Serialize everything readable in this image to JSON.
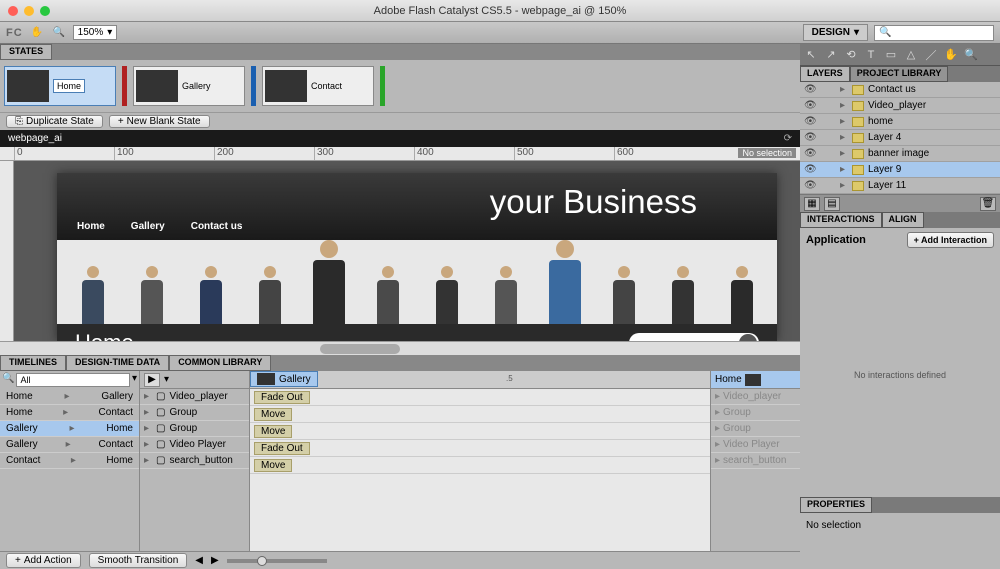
{
  "titlebar": {
    "text": "Adobe Flash Catalyst CS5.5 - webpage_ai @ 150%"
  },
  "toolbar": {
    "fc": "FC",
    "zoom": "150%",
    "design": "DESIGN"
  },
  "states": {
    "tab": "STATES",
    "items": [
      {
        "label": "Home",
        "active": true,
        "barColor": "#b02020"
      },
      {
        "label": "Gallery",
        "active": false,
        "barColor": "#1a5fb0"
      },
      {
        "label": "Contact",
        "active": false,
        "barColor": "#2aa52a"
      }
    ],
    "dup": "Duplicate State",
    "newblank": "New Blank State"
  },
  "canvas": {
    "doc": "webpage_ai",
    "nosel": "No selection",
    "hero_title": "your Business",
    "nav": [
      "Home",
      "Gallery",
      "Contact us"
    ],
    "page_heading": "Home"
  },
  "layers": {
    "tab1": "LAYERS",
    "tab2": "PROJECT LIBRARY",
    "items": [
      "Contact us",
      "Video_player",
      "home",
      "Layer 4",
      "banner image",
      "Layer 9",
      "Layer 11"
    ],
    "selected": 5
  },
  "interactions": {
    "tab1": "INTERACTIONS",
    "tab2": "ALIGN",
    "heading": "Application",
    "add": "+  Add Interaction",
    "empty": "No interactions defined"
  },
  "properties": {
    "tab": "PROPERTIES",
    "text": "No selection"
  },
  "timelines": {
    "tab1": "TIMELINES",
    "tab2": "DESIGN-TIME DATA",
    "tab3": "COMMON LIBRARY",
    "search": "All",
    "transitions": [
      {
        "from": "Home",
        "to": "Gallery"
      },
      {
        "from": "Home",
        "to": "Contact"
      },
      {
        "from": "Gallery",
        "to": "Home"
      },
      {
        "from": "Gallery",
        "to": "Contact"
      },
      {
        "from": "Contact",
        "to": "Home"
      }
    ],
    "sel_trans": 2,
    "mid_items": [
      "Video_player",
      "Group",
      "Group",
      "Video Player",
      "search_button"
    ],
    "from_state": "Gallery",
    "to_state": "Home",
    "clips": [
      "Fade Out",
      "Move",
      "Move",
      "Fade Out",
      "Move"
    ],
    "far_items": [
      "Video_player",
      "Group",
      "Group",
      "Video Player",
      "search_button"
    ],
    "tick": ".5",
    "add_action": "Add Action",
    "smooth": "Smooth Transition"
  }
}
